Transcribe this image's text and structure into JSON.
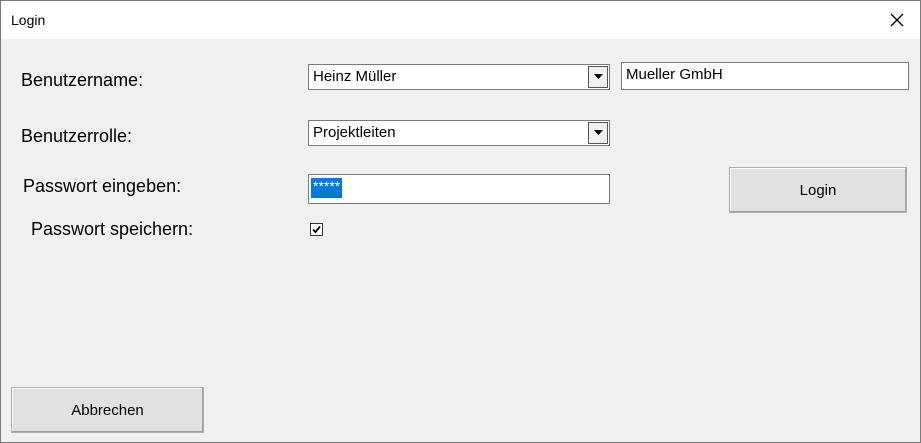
{
  "window": {
    "title": "Login"
  },
  "fields": {
    "username_label": "Benutzername:",
    "username_value": "Heinz Müller",
    "company_value": "Mueller GmbH",
    "role_label": "Benutzerrolle:",
    "role_value": "Projektleiten",
    "password_label": "Passwort eingeben:",
    "password_value": "*****",
    "save_password_label": "Passwort speichern:",
    "save_password_checked": true
  },
  "buttons": {
    "login": "Login",
    "cancel": "Abbrechen"
  },
  "icons": {
    "close": "close-icon",
    "dropdown": "chevron-down-icon",
    "check": "check-icon"
  },
  "colors": {
    "selection": "#0078d7",
    "window_bg": "#f0f0f0"
  }
}
